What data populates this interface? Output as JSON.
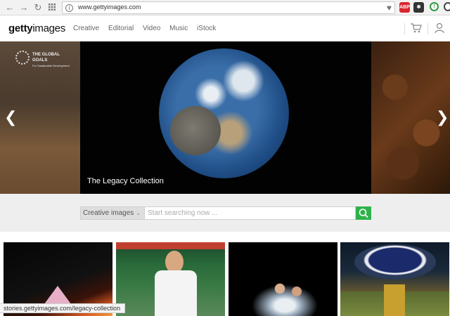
{
  "browser": {
    "url": "www.gettyimages.com",
    "extensions": [
      {
        "icon": "adblock-plus-icon",
        "label": "ABP",
        "color": "#d9262e"
      },
      {
        "icon": "puzzle-extension-icon",
        "label": "",
        "color": "#333333"
      },
      {
        "icon": "green-extension-icon",
        "label": "",
        "color": "#2e9a3e"
      }
    ]
  },
  "site": {
    "logo_bold": "getty",
    "logo_light": "images",
    "nav": [
      "Creative",
      "Editorial",
      "Video",
      "Music",
      "iStock"
    ]
  },
  "hero": {
    "caption": "The Legacy Collection",
    "badge_line1": "THE GLOBAL GOALS",
    "badge_line2": "For Sustainable Development"
  },
  "search": {
    "select_value": "Creative images",
    "placeholder": "Start searching now ...",
    "button_color": "#2fb24c"
  },
  "thumbnails": [
    {
      "name": "prism-light-thumbnail"
    },
    {
      "name": "baseball-player-thumbnail"
    },
    {
      "name": "water-splash-dancers-thumbnail"
    },
    {
      "name": "assembly-hall-thumbnail"
    }
  ],
  "status_bar": {
    "text": "stories.gettyimages.com/legacy-collection"
  }
}
